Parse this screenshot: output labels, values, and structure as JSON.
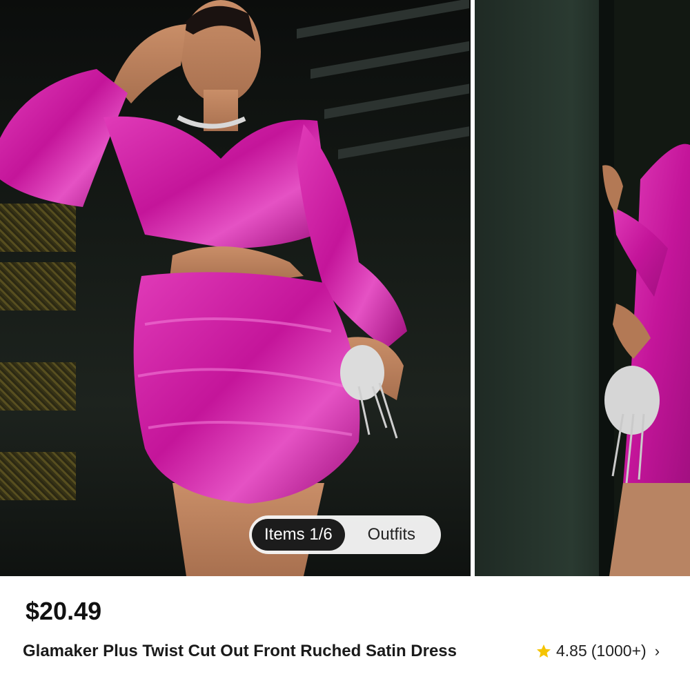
{
  "gallery": {
    "badge": {
      "items_label": "Items 1/6",
      "outfits_label": "Outfits"
    }
  },
  "product": {
    "price": "$20.49",
    "title": "Glamaker Plus Twist Cut Out Front Ruched Satin Dress",
    "rating": {
      "score": "4.85",
      "count": "(1000+)"
    }
  },
  "colors": {
    "dress": "#c4159a",
    "star": "#f5c400",
    "badge_active": "#1c1c1c"
  }
}
